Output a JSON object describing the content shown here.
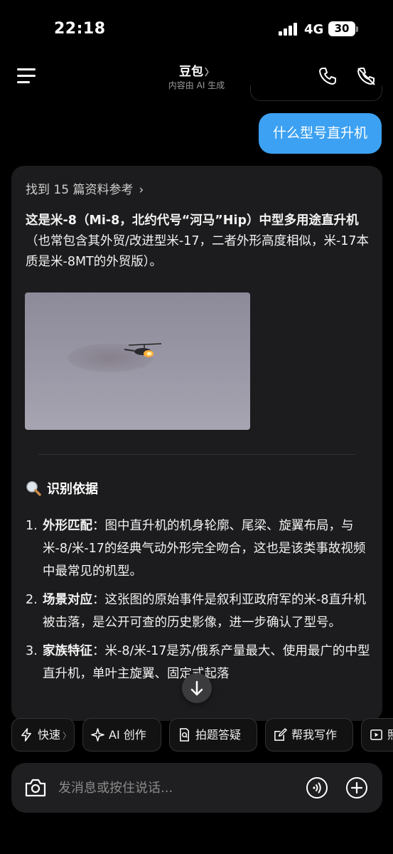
{
  "status_bar": {
    "time": "22:18",
    "network": "4G",
    "battery": "30"
  },
  "header": {
    "bot_name": "豆包",
    "bot_name_chevron": "〉",
    "ai_notice": "内容由 AI 生成",
    "icons": [
      "menu-icon",
      "phone-icon",
      "mute-icon"
    ]
  },
  "user_message": "什么型号直升机",
  "answer": {
    "references": "找到 15 篇资料参考",
    "intro_bold": "这是米-8（Mi-8，北约代号“河马”Hip）中型多用途直升机",
    "intro_rest": "（也常包含其外贸/改进型米-17，二者外形高度相似，米-17本质是米-8MT的外贸版）。",
    "section_title": "识别依据",
    "points": [
      {
        "num": "1.",
        "label": "外形匹配",
        "text": "：图中直升机的机身轮廓、尾梁、旋翼布局，与米-8/米-17的经典气动外形完全吻合，这也是该类事故视频中最常见的机型。"
      },
      {
        "num": "2.",
        "label": "场景对应",
        "text": "：这张图的原始事件是叙利亚政府军的米-8直升机被击落，是公开可查的历史影像，进一步确认了型号。"
      },
      {
        "num": "3.",
        "label": "家族特征",
        "text": "：米-8/米-17是苏/俄系产量最大、使用最广的中型直升机，单叶主旋翼、固定式起落"
      }
    ]
  },
  "shortcuts": [
    {
      "label": "快速",
      "icon": "lightning-icon",
      "tail": "〉"
    },
    {
      "label": "AI 创作",
      "icon": "sparkle-icon"
    },
    {
      "label": "拍题答疑",
      "icon": "doc-search-icon"
    },
    {
      "label": "帮我写作",
      "icon": "edit-icon"
    },
    {
      "label": "照",
      "icon": "image-icon"
    }
  ],
  "input": {
    "placeholder": "发消息或按住说话..."
  },
  "colors": {
    "accent": "#3ca1f2",
    "card_bg": "#1c1c1e",
    "page_bg": "#000000"
  }
}
